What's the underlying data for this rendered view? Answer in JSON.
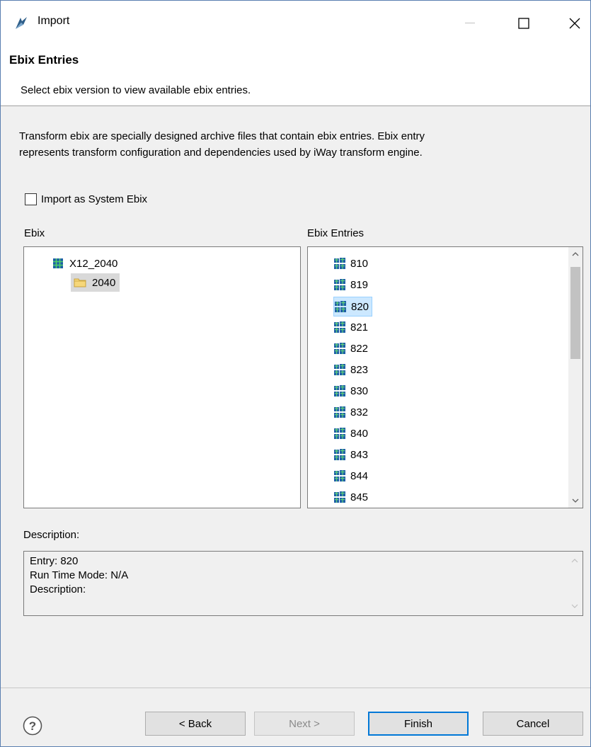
{
  "window": {
    "title": "Import"
  },
  "banner": {
    "title": "Ebix Entries",
    "message": "Select ebix version to view available ebix entries."
  },
  "intro": {
    "line1": "Transform ebix are specially designed archive files that contain ebix entries. Ebix entry",
    "line2": "represents transform configuration and dependencies used by iWay transform engine."
  },
  "import_system": {
    "label": "Import as System Ebix",
    "checked": false
  },
  "ebix_panel": {
    "label": "Ebix",
    "root": "X12_2040",
    "child": "2040"
  },
  "entries_panel": {
    "label": "Ebix Entries",
    "items": [
      "810",
      "819",
      "820",
      "821",
      "822",
      "823",
      "830",
      "832",
      "840",
      "843",
      "844",
      "845"
    ],
    "selected": "820"
  },
  "description": {
    "label": "Description:",
    "line1": "Entry: 820",
    "line2": "Run Time Mode: N/A",
    "line3": "Description:"
  },
  "buttons": {
    "back": "< Back",
    "next": "Next >",
    "finish": "Finish",
    "cancel": "Cancel"
  }
}
